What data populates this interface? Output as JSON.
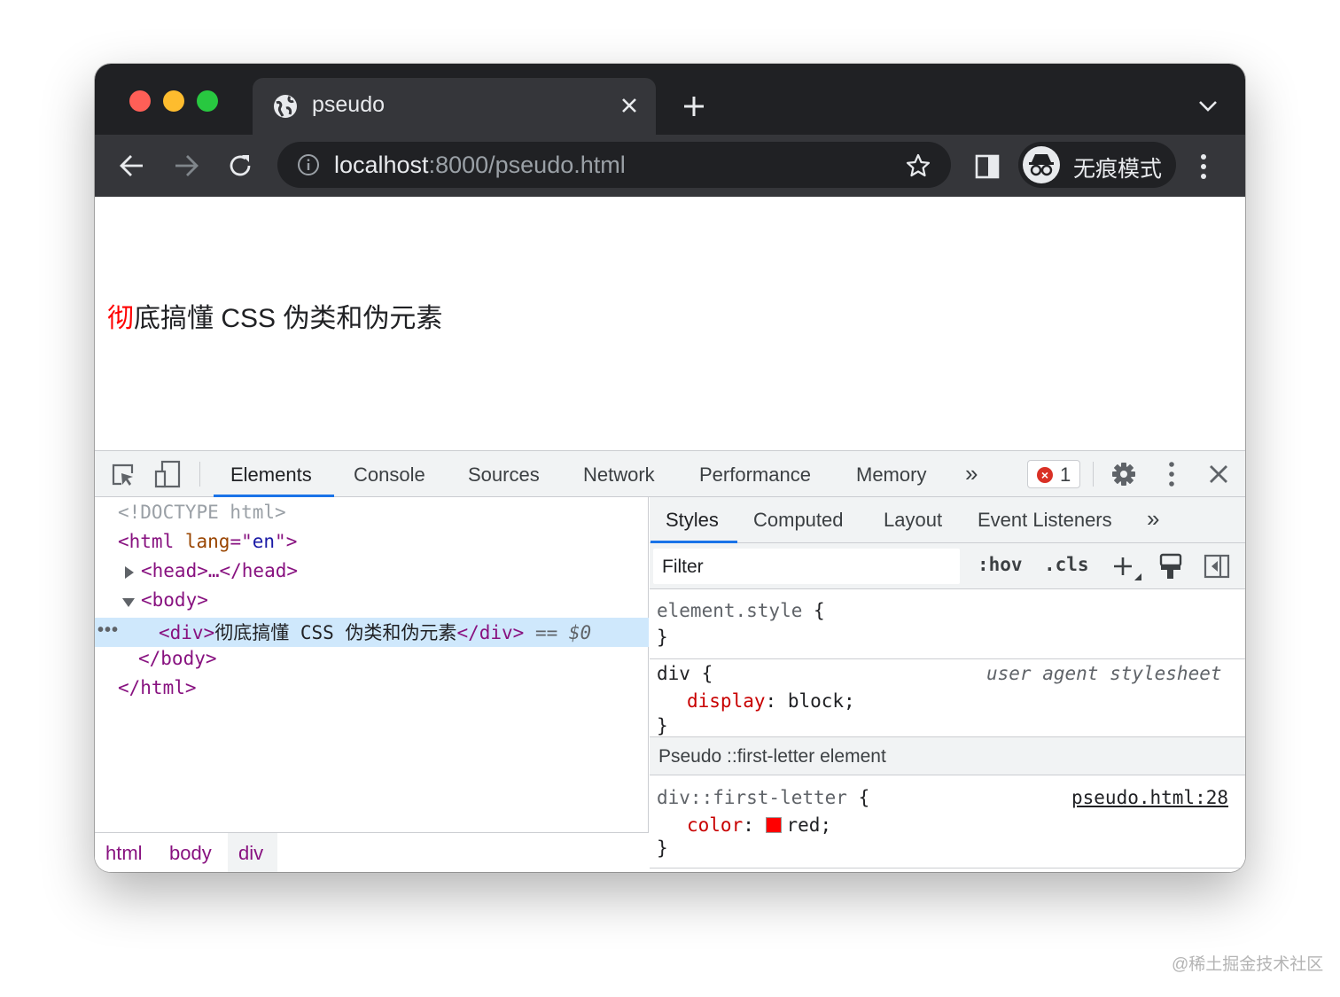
{
  "browser": {
    "tab": {
      "title": "pseudo"
    },
    "address": {
      "host": "localhost",
      "rest": ":8000/pseudo.html"
    },
    "incognito": {
      "label": "无痕模式"
    },
    "icons": [
      "globe-icon",
      "close-icon",
      "plus-icon",
      "chevron-down-icon",
      "back-icon",
      "forward-icon",
      "reload-icon",
      "info-icon",
      "star-icon",
      "sidepanel-icon",
      "incognito-icon",
      "more-vert-icon"
    ]
  },
  "page": {
    "first_letter": "彻",
    "rest": "底搞懂 CSS 伪类和伪元素",
    "first_letter_color": "#ff0000"
  },
  "devtools": {
    "tabs": [
      "Elements",
      "Console",
      "Sources",
      "Network",
      "Performance",
      "Memory"
    ],
    "more": "»",
    "errors": {
      "count": "1"
    },
    "elements": {
      "doctype": "<!DOCTYPE html>",
      "html_open": {
        "tag": "<html",
        "attr": "lang",
        "eq": "=\"",
        "val": "en",
        "close": "\">"
      },
      "head": "<head>…</head>",
      "body_open": "<body>",
      "div": {
        "open": "<div>",
        "text": "彻底搞懂 CSS 伪类和伪元素",
        "close": "</div>",
        "eq": " == ",
        "var": "$0"
      },
      "body_close": "</body>",
      "html_close": "</html>",
      "dots": "•••"
    },
    "breadcrumbs": [
      "html",
      "body",
      "div"
    ],
    "styles": {
      "tabs": [
        "Styles",
        "Computed",
        "Layout",
        "Event Listeners"
      ],
      "more": "»",
      "filter_placeholder": "Filter",
      "hov": ":hov",
      "cls": ".cls",
      "element_style": {
        "selector": "element.style",
        "open": " {",
        "close": "}"
      },
      "ua_rule": {
        "selector": "div",
        "open": " {",
        "origin": "user agent stylesheet",
        "prop": "display",
        "colon": ": ",
        "value": "block;",
        "close": "}"
      },
      "pseudo_header": "Pseudo ::first-letter element",
      "pseudo_rule": {
        "selector": "div::first-letter",
        "open": " {",
        "source": "pseudo.html:28",
        "prop": "color",
        "colon": ": ",
        "value": "red;",
        "close": "}"
      },
      "swatch_color": "#ff0000"
    }
  },
  "watermark": "@稀土掘金技术社区"
}
